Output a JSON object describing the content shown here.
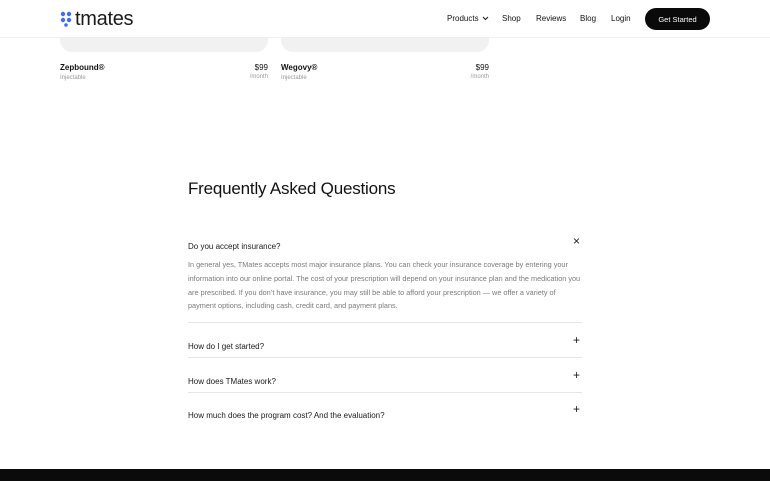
{
  "header": {
    "brand": "tmates",
    "nav": {
      "products": "Products",
      "shop": "Shop",
      "reviews": "Reviews",
      "blog": "Blog",
      "login": "Login"
    },
    "cta_label": "Get Started"
  },
  "products": [
    {
      "name": "Zepbound®",
      "type": "Injectable",
      "price": "$99",
      "per": "/month"
    },
    {
      "name": "Wegovy®",
      "type": "Injectable",
      "price": "$99",
      "per": "/month"
    }
  ],
  "faq": {
    "title": "Frequently Asked Questions",
    "items": [
      {
        "question": "Do you accept insurance?",
        "expanded": true,
        "answer": "In general yes, TMates accepts most major insurance plans. You can check your insurance coverage by entering your information into our online portal. The cost of your prescription will depend on your insurance plan and the medication you are prescribed. If you don’t have insurance, you may still be able to afford your prescription — we offer a variety of payment options, including cash, credit card, and payment plans."
      },
      {
        "question": "How do I get started?",
        "expanded": false
      },
      {
        "question": "How does TMates work?",
        "expanded": false
      },
      {
        "question": "How much does the program cost? And the evaluation?",
        "expanded": false
      }
    ]
  },
  "icons": {
    "close": "×",
    "expand": "+"
  },
  "colors": {
    "accent": "#3b6df5",
    "cta_bg": "#0a0a0a",
    "muted_text": "#7a7a7a"
  }
}
